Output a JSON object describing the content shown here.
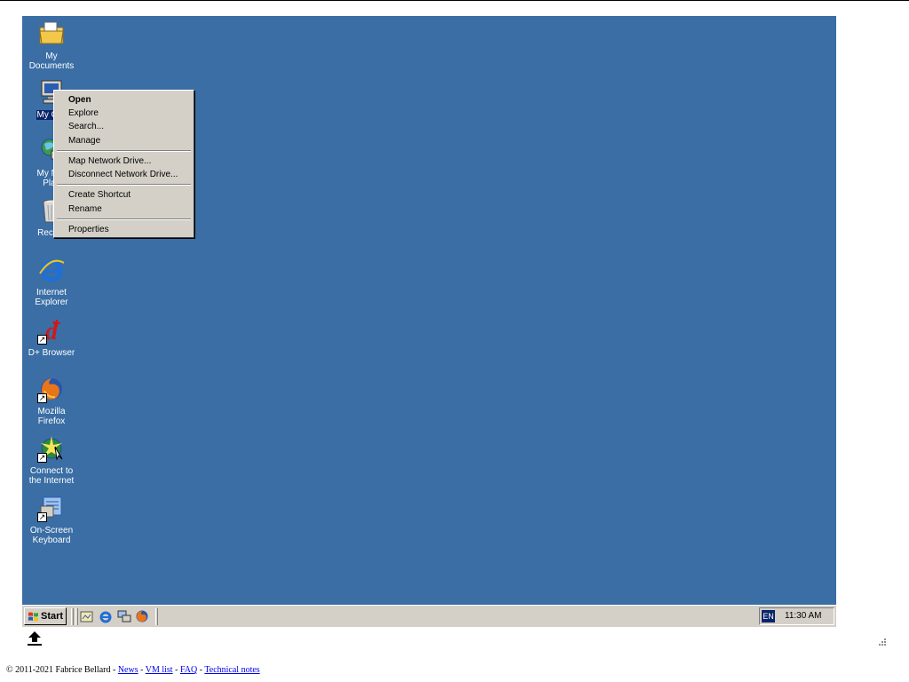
{
  "desktop": {
    "background_color": "#3a6ea5",
    "icons": [
      {
        "label": "My Documents",
        "icon": "folder-icon"
      },
      {
        "label": "My Computer",
        "icon": "computer-icon"
      },
      {
        "label": "My Network Places",
        "icon": "network-icon"
      },
      {
        "label": "Recycle Bin",
        "icon": "recycle-bin-icon"
      },
      {
        "label": "Internet Explorer",
        "icon": "ie-icon"
      },
      {
        "label": "D+ Browser",
        "icon": "d-plus-icon"
      },
      {
        "label": "Mozilla Firefox",
        "icon": "firefox-icon"
      },
      {
        "label": "Connect to the Internet",
        "icon": "connect-icon"
      },
      {
        "label": "On-Screen Keyboard",
        "icon": "keyboard-icon"
      }
    ],
    "icon_lines": {
      "my_documents": [
        "My Documents"
      ],
      "my_computer": [
        "My Co"
      ],
      "my_network": [
        "My Ne",
        "Plac"
      ],
      "recycle": [
        "Recyc"
      ],
      "ie": [
        "Internet",
        "Explorer"
      ],
      "dplus": [
        "D+ Browser"
      ],
      "firefox": [
        "Mozilla Firefox"
      ],
      "connect": [
        "Connect to",
        "the Internet"
      ],
      "keyboard": [
        "On-Screen",
        "Keyboard"
      ]
    }
  },
  "context_menu": {
    "open": "Open",
    "explore": "Explore",
    "search": "Search...",
    "manage": "Manage",
    "map_drive": "Map Network Drive...",
    "disconnect_drive": "Disconnect Network Drive...",
    "create_shortcut": "Create Shortcut",
    "rename": "Rename",
    "properties": "Properties"
  },
  "taskbar": {
    "start_label": "Start",
    "quick_launch": [
      "show-desktop-icon",
      "ie-icon",
      "network-icon",
      "firefox-icon"
    ],
    "language": "EN",
    "clock": "11:30 AM"
  },
  "footer": {
    "copyright": "© 2011-2021 Fabrice Bellard - ",
    "news": "News",
    "sep1": " - ",
    "vm_list": "VM list",
    "sep2": " - ",
    "faq": "FAQ",
    "sep3": " - ",
    "technical_notes": "Technical notes"
  }
}
